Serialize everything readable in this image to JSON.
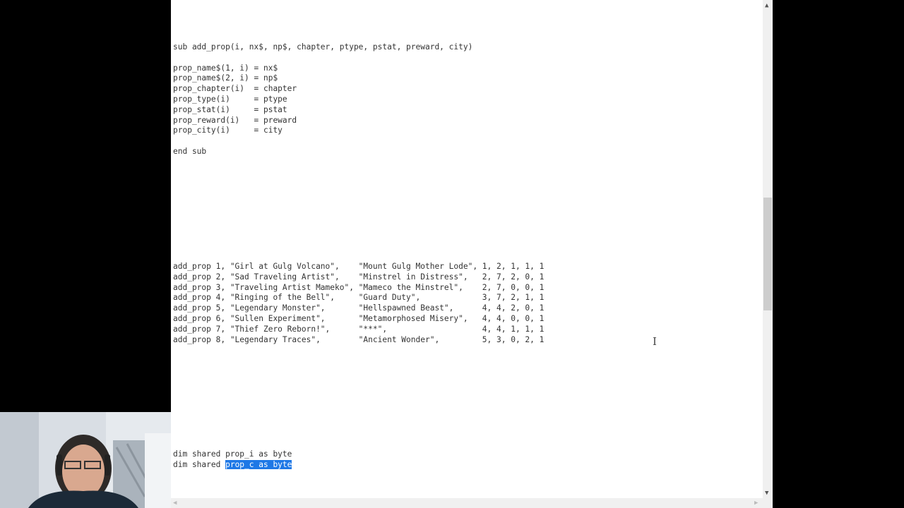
{
  "editor": {
    "sub_block": [
      "sub add_prop(i, nx$, np$, chapter, ptype, pstat, preward, city)",
      "",
      "prop_name$(1, i) = nx$",
      "prop_name$(2, i) = np$",
      "prop_chapter(i)  = chapter",
      "prop_type(i)     = ptype",
      "prop_stat(i)     = pstat",
      "prop_reward(i)   = preward",
      "prop_city(i)     = city",
      "",
      "end sub"
    ],
    "calls_block": [
      "add_prop 1, \"Girl at Gulg Volcano\",    \"Mount Gulg Mother Lode\", 1, 2, 1, 1, 1",
      "add_prop 2, \"Sad Traveling Artist\",    \"Minstrel in Distress\",   2, 7, 2, 0, 1",
      "add_prop 3, \"Traveling Artist Mameko\", \"Mameco the Minstrel\",    2, 7, 0, 0, 1",
      "add_prop 4, \"Ringing of the Bell\",     \"Guard Duty\",             3, 7, 2, 1, 1",
      "add_prop 5, \"Legendary Monster\",       \"Hellspawned Beast\",      4, 4, 2, 0, 1",
      "add_prop 6, \"Sullen Experiment\",       \"Metamorphosed Misery\",   4, 4, 0, 0, 1",
      "add_prop 7, \"Thief Zero Reborn!\",      \"***\",                    4, 4, 1, 1, 1",
      "add_prop 8, \"Legendary Traces\",        \"Ancient Wonder\",         5, 3, 0, 2, 1"
    ],
    "dim_line_1": "dim shared prop_i as byte",
    "dim_line_2_prefix": "dim shared ",
    "dim_line_2_selected": "prop_c as byte"
  },
  "icons": {
    "scroll_up": "scroll-up-arrow",
    "scroll_down": "scroll-down-arrow",
    "text_cursor": "i-beam-cursor"
  }
}
